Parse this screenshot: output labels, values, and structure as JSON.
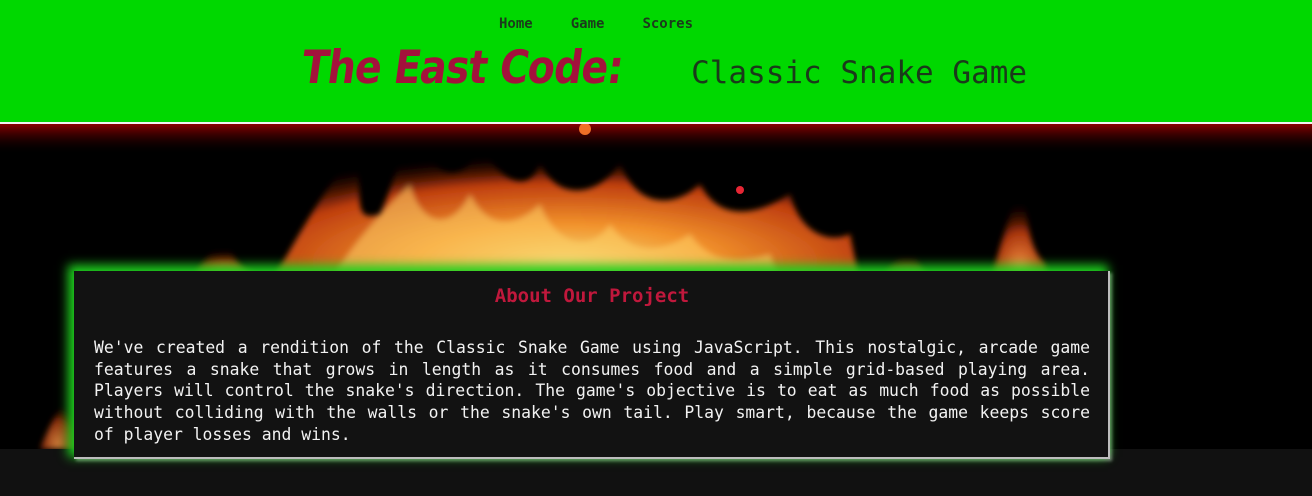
{
  "nav": {
    "items": [
      {
        "label": "Home"
      },
      {
        "label": "Game"
      },
      {
        "label": "Scores"
      }
    ]
  },
  "header": {
    "brand": "The East Code:",
    "subtitle": "Classic Snake Game"
  },
  "about": {
    "title": "About Our Project",
    "body": "We've created a rendition of the Classic Snake Game using JavaScript. This nostalgic, arcade game features a snake that grows in length as it consumes food and a simple grid-based playing area. Players will control the snake's direction. The game's objective is to eat as much food as possible without colliding with the walls or the snake's own tail. Play smart, because the game keeps score of player losses and wins."
  },
  "colors": {
    "header_bg": "#00d800",
    "brand": "#a3123c",
    "card_title": "#c0183c",
    "card_bg": "#121212",
    "glow": "#1fd11f"
  }
}
